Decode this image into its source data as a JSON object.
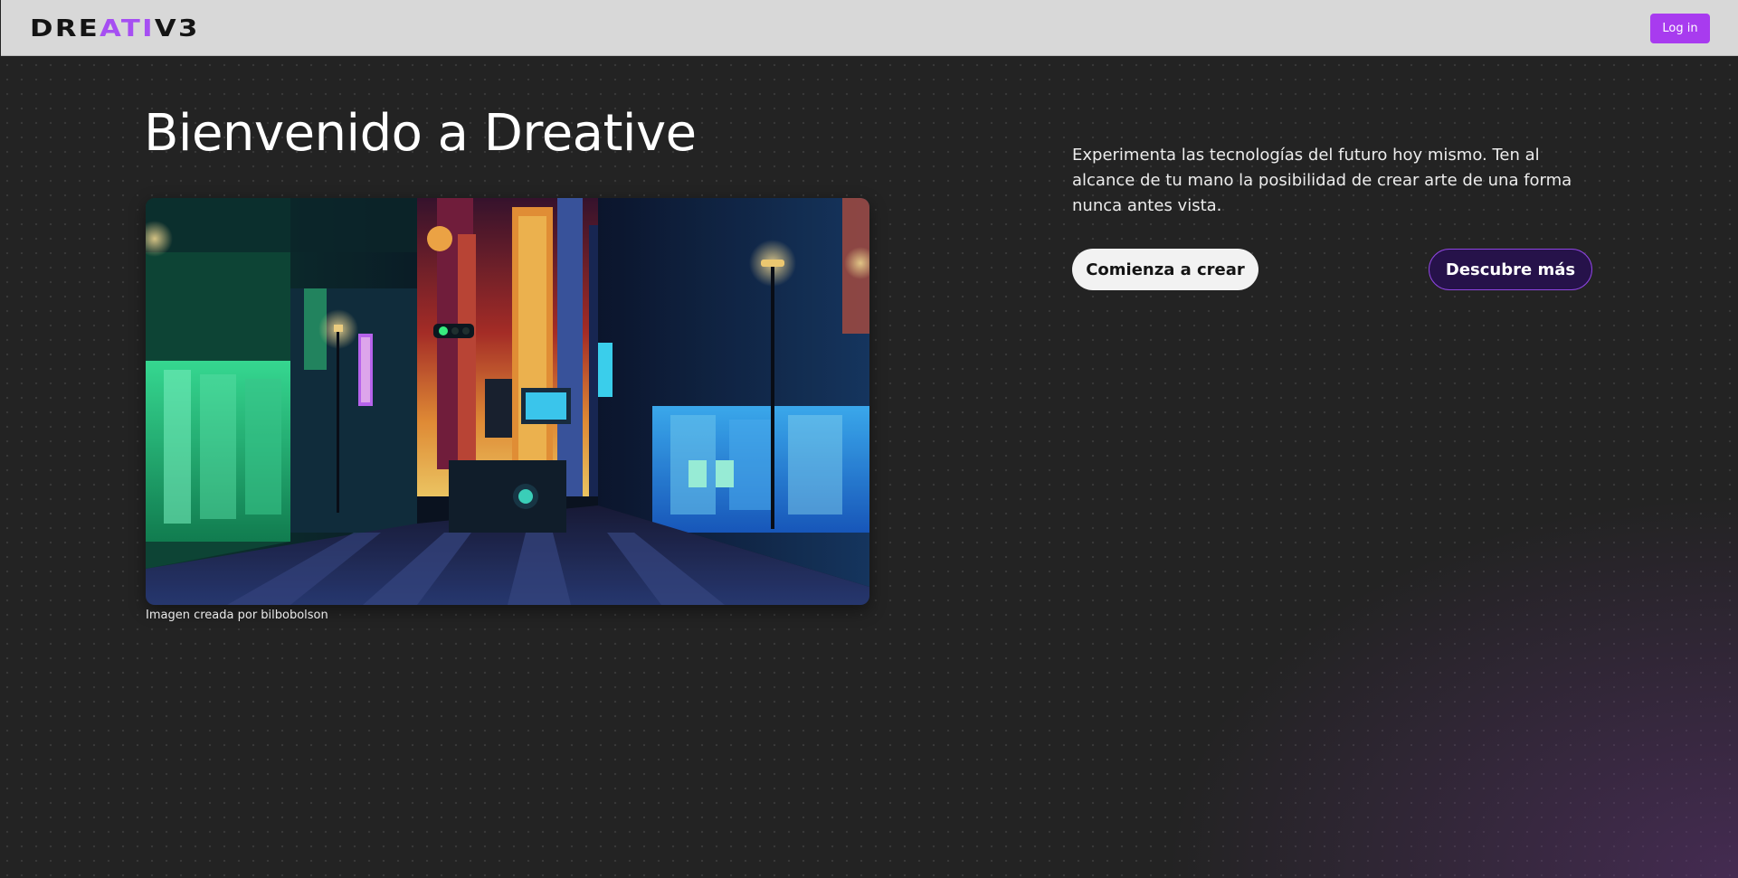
{
  "header": {
    "logo": {
      "before": "DRE",
      "accent": "ATI",
      "after": "V3",
      "accent_color": "#a64ff2"
    },
    "login_label": "Log in",
    "login_color": "#a83bef"
  },
  "hero": {
    "title": "Bienvenido a Dreative",
    "image_caption": "Imagen creada por bilbobolson",
    "description": "Experimenta las tecnologías del futuro hoy mismo. Ten al alcance de tu mano la posibilidad de crear arte de una forma nunca antes vista.",
    "primary_button": "Comienza a crear",
    "secondary_button": "Descubre más"
  },
  "colors": {
    "background": "#232323",
    "topbar": "#d8d8d8",
    "secondary_button_bg": "#26124a",
    "secondary_button_border": "#8e45e0"
  }
}
